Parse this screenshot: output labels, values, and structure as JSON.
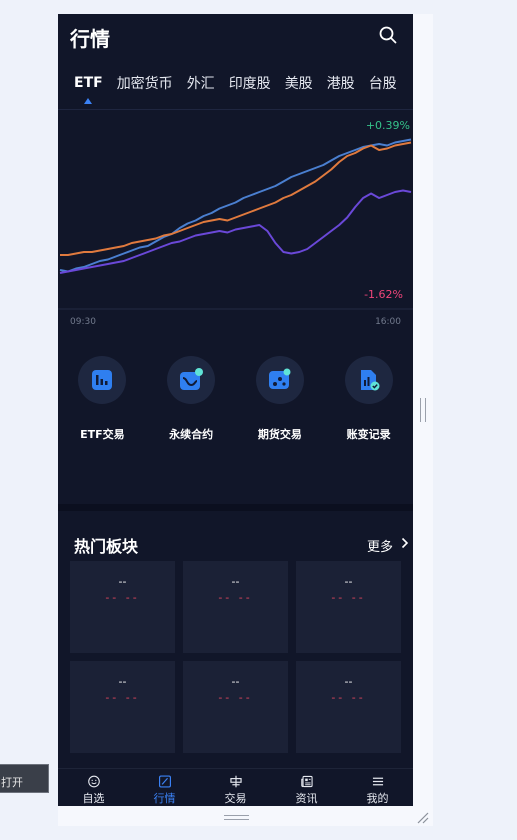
{
  "header": {
    "title": "行情"
  },
  "market_tabs": [
    "ETF",
    "加密货币",
    "外汇",
    "印度股",
    "美股",
    "港股",
    "台股"
  ],
  "active_tab": "ETF",
  "chart_data": {
    "type": "line",
    "x_start_label": "09:30",
    "x_end_label": "16:00",
    "change_labels": {
      "high": "+0.39%",
      "low": "-1.62%"
    },
    "series": [
      {
        "color": "#4a7fd0",
        "values": [
          12,
          11,
          13,
          14,
          16,
          18,
          19,
          21,
          23,
          25,
          27,
          28,
          31,
          34,
          36,
          40,
          43,
          45,
          48,
          50,
          53,
          55,
          57,
          60,
          62,
          64,
          66,
          68,
          71,
          74,
          76,
          78,
          80,
          82,
          85,
          88,
          90,
          92,
          94,
          95,
          96,
          95,
          97,
          98,
          99
        ]
      },
      {
        "color": "#e07a3e",
        "values": [
          22,
          22,
          23,
          24,
          24,
          25,
          26,
          27,
          28,
          30,
          31,
          32,
          33,
          35,
          36,
          38,
          40,
          42,
          44,
          45,
          46,
          45,
          47,
          49,
          51,
          53,
          55,
          57,
          60,
          62,
          65,
          68,
          71,
          75,
          79,
          84,
          88,
          90,
          93,
          95,
          92,
          93,
          95,
          96,
          97
        ]
      },
      {
        "color": "#6a48d8",
        "values": [
          10,
          11,
          12,
          13,
          14,
          15,
          16,
          17,
          18,
          20,
          22,
          24,
          26,
          28,
          30,
          31,
          33,
          35,
          36,
          37,
          38,
          37,
          39,
          40,
          41,
          42,
          38,
          30,
          24,
          23,
          24,
          26,
          30,
          34,
          38,
          42,
          47,
          54,
          60,
          63,
          60,
          62,
          64,
          65,
          64
        ]
      }
    ]
  },
  "shortcuts": [
    {
      "label": "ETF交易",
      "icon": "etf-trade-icon"
    },
    {
      "label": "永续合约",
      "icon": "perpetual-contract-icon"
    },
    {
      "label": "期货交易",
      "icon": "futures-trade-icon"
    },
    {
      "label": "账变记录",
      "icon": "account-record-icon"
    }
  ],
  "hot_sectors": {
    "title": "热门板块",
    "more_label": "更多",
    "cards": [
      {
        "name": "--",
        "change": "-- --"
      },
      {
        "name": "--",
        "change": "-- --"
      },
      {
        "name": "--",
        "change": "-- --"
      },
      {
        "name": "--",
        "change": "-- --"
      },
      {
        "name": "--",
        "change": "-- --"
      },
      {
        "name": "--",
        "change": "-- --"
      }
    ]
  },
  "bottom_nav": [
    {
      "label": "自选",
      "icon": "smiley-icon",
      "active": false
    },
    {
      "label": "行情",
      "icon": "market-chart-icon",
      "active": true
    },
    {
      "label": "交易",
      "icon": "trade-icon",
      "active": false
    },
    {
      "label": "资讯",
      "icon": "news-icon",
      "active": false
    },
    {
      "label": "我的",
      "icon": "menu-icon",
      "active": false
    }
  ],
  "toast": {
    "text": "打开"
  },
  "colors": {
    "background": "#111629",
    "accent": "#3b82f6",
    "up": "#35c28a",
    "down": "#f0457a"
  }
}
